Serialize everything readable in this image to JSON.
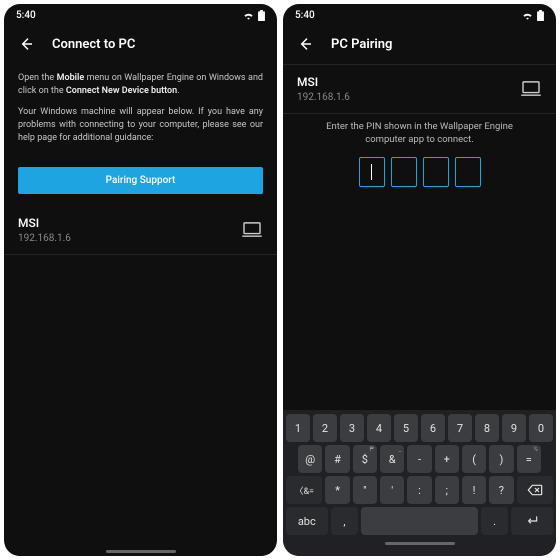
{
  "status": {
    "time": "5:40"
  },
  "screen1": {
    "title": "Connect to PC",
    "para1_a": "Open the ",
    "para1_b": "Mobile",
    "para1_c": " menu on Wallpaper Engine on Windows and click on the ",
    "para1_d": "Connect New Device button",
    "para1_e": ".",
    "para2": "Your Windows machine will appear below. If you have any problems with connecting to your computer, please see our help page for additional guidance:",
    "button": "Pairing Support",
    "device_name": "MSI",
    "device_ip": "192.168.1.6"
  },
  "screen2": {
    "title": "PC Pairing",
    "device_name": "MSI",
    "device_ip": "192.168.1.6",
    "instruction": "Enter the PIN shown in the Wallpaper Engine computer app to connect."
  },
  "keyboard": {
    "row1": [
      "1",
      "2",
      "3",
      "4",
      "5",
      "6",
      "7",
      "8",
      "9",
      "0"
    ],
    "row2": [
      {
        "m": "@",
        "s": ""
      },
      {
        "m": "#",
        "s": ""
      },
      {
        "m": "$",
        "s": "₱"
      },
      {
        "m": "&",
        "s": "_"
      },
      {
        "m": "-",
        "s": ""
      },
      {
        "m": "+",
        "s": ""
      },
      {
        "m": "(",
        "s": ""
      },
      {
        "m": ")",
        "s": ""
      },
      {
        "m": "=",
        "s": "%"
      }
    ],
    "row3_shift": "〈&=",
    "row3": [
      {
        "m": "*",
        "s": ""
      },
      {
        "m": "\"",
        "s": ""
      },
      {
        "m": "'",
        "s": ""
      },
      {
        "m": ":",
        "s": ""
      },
      {
        "m": ";",
        "s": ""
      },
      {
        "m": "!",
        "s": ""
      },
      {
        "m": "?",
        "s": ""
      }
    ],
    "row4_mode": "abc",
    "row4_comma": ",",
    "row4_period": "."
  }
}
